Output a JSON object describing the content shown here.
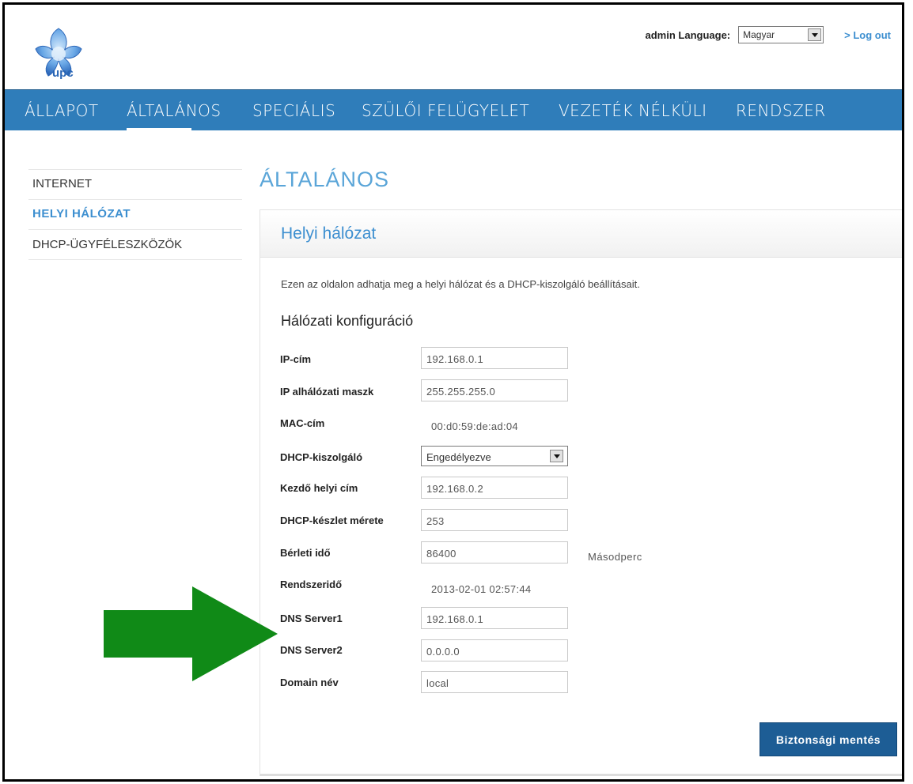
{
  "header": {
    "logo_text": "upc",
    "admin_language_label": "admin Language:",
    "language_selected": "Magyar",
    "logout_label": "> Log out"
  },
  "nav": {
    "items": [
      "ÁLLAPOT",
      "ÁLTALÁNOS",
      "SPECIÁLIS",
      "SZÜLŐI FELÜGYELET",
      "VEZETÉK NÉLKÜLI",
      "RENDSZER"
    ],
    "active": "ÁLTALÁNOS"
  },
  "sidebar": {
    "items": [
      "INTERNET",
      "HELYI HÁLÓZAT",
      "DHCP-ÜGYFÉLESZKÖZÖK"
    ],
    "active": "HELYI HÁLÓZAT"
  },
  "main": {
    "page_title": "ÁLTALÁNOS",
    "panel_title": "Helyi hálózat",
    "description": "Ezen az oldalon adhatja meg a helyi hálózat és a DHCP-kiszolgáló beállításait.",
    "section_title": "Hálózati konfiguráció",
    "fields": {
      "ip": {
        "label": "IP-cím",
        "value": "192.168.0.1"
      },
      "subnet": {
        "label": "IP alhálózati maszk",
        "value": "255.255.255.0"
      },
      "mac": {
        "label": "MAC-cím",
        "value": "00:d0:59:de:ad:04"
      },
      "dhcp_server": {
        "label": "DHCP-kiszolgáló",
        "value": "Engedélyezve"
      },
      "start_addr": {
        "label": "Kezdő helyi cím",
        "value": "192.168.0.2"
      },
      "pool_size": {
        "label": "DHCP-készlet mérete",
        "value": "253"
      },
      "lease": {
        "label": "Bérleti idő",
        "value": "86400",
        "unit": "Másodperc"
      },
      "system_time": {
        "label": "Rendszeridő",
        "value": "2013-02-01 02:57:44"
      },
      "dns1": {
        "label": "DNS Server1",
        "value": "192.168.0.1"
      },
      "dns2": {
        "label": "DNS Server2",
        "value": "0.0.0.0"
      },
      "domain": {
        "label": "Domain név",
        "value": "local"
      }
    },
    "save_label": "Biztonsági mentés"
  },
  "colors": {
    "nav_bg": "#2f7dba",
    "accent": "#3d8fd0",
    "button_bg": "#1d5d95",
    "arrow": "#108a17"
  }
}
